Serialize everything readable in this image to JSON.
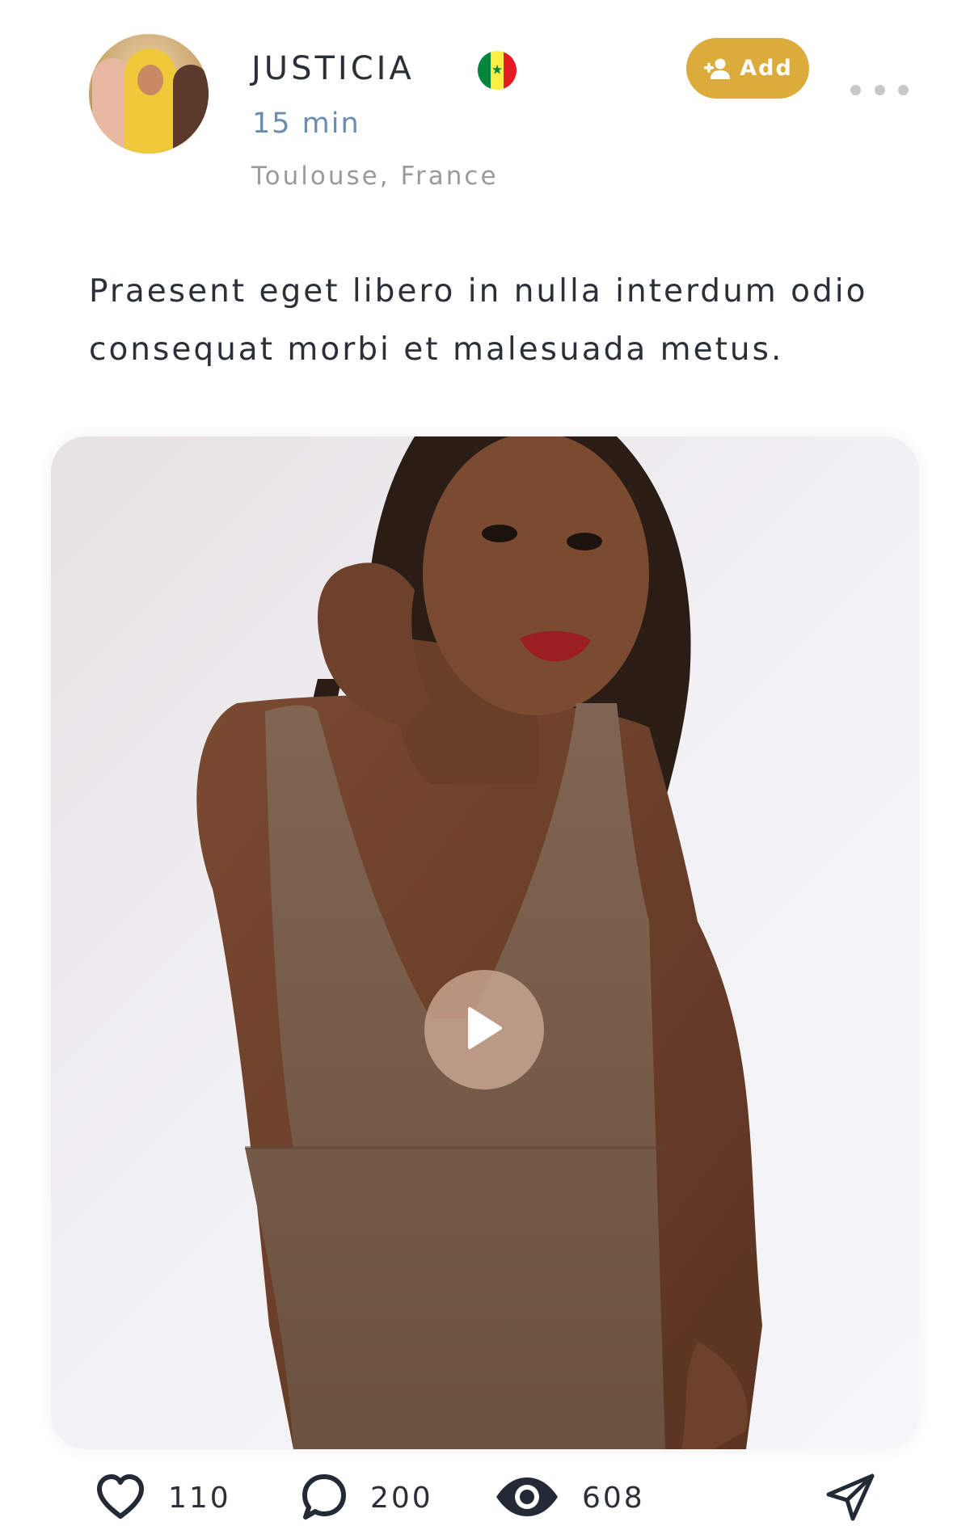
{
  "post": {
    "user": {
      "name": "JUSTICIA",
      "time": "15 min",
      "location": "Toulouse, France",
      "flag_colors": [
        "#00853f",
        "#fdef42",
        "#e31b23"
      ]
    },
    "add_button": {
      "label": "Add",
      "icon": "person-add-icon",
      "color": "#dbab3b"
    },
    "more_icon": "more-horizontal-icon",
    "text": "Praesent eget libero in nulla interdum odio consequat morbi et malesuada metus.",
    "media": {
      "type": "video",
      "play_icon": "play-icon"
    },
    "actions": {
      "likes": "110",
      "comments": "200",
      "views": "608",
      "like_icon": "heart-icon",
      "comment_icon": "comment-icon",
      "views_icon": "eye-icon",
      "share_icon": "send-icon"
    }
  }
}
